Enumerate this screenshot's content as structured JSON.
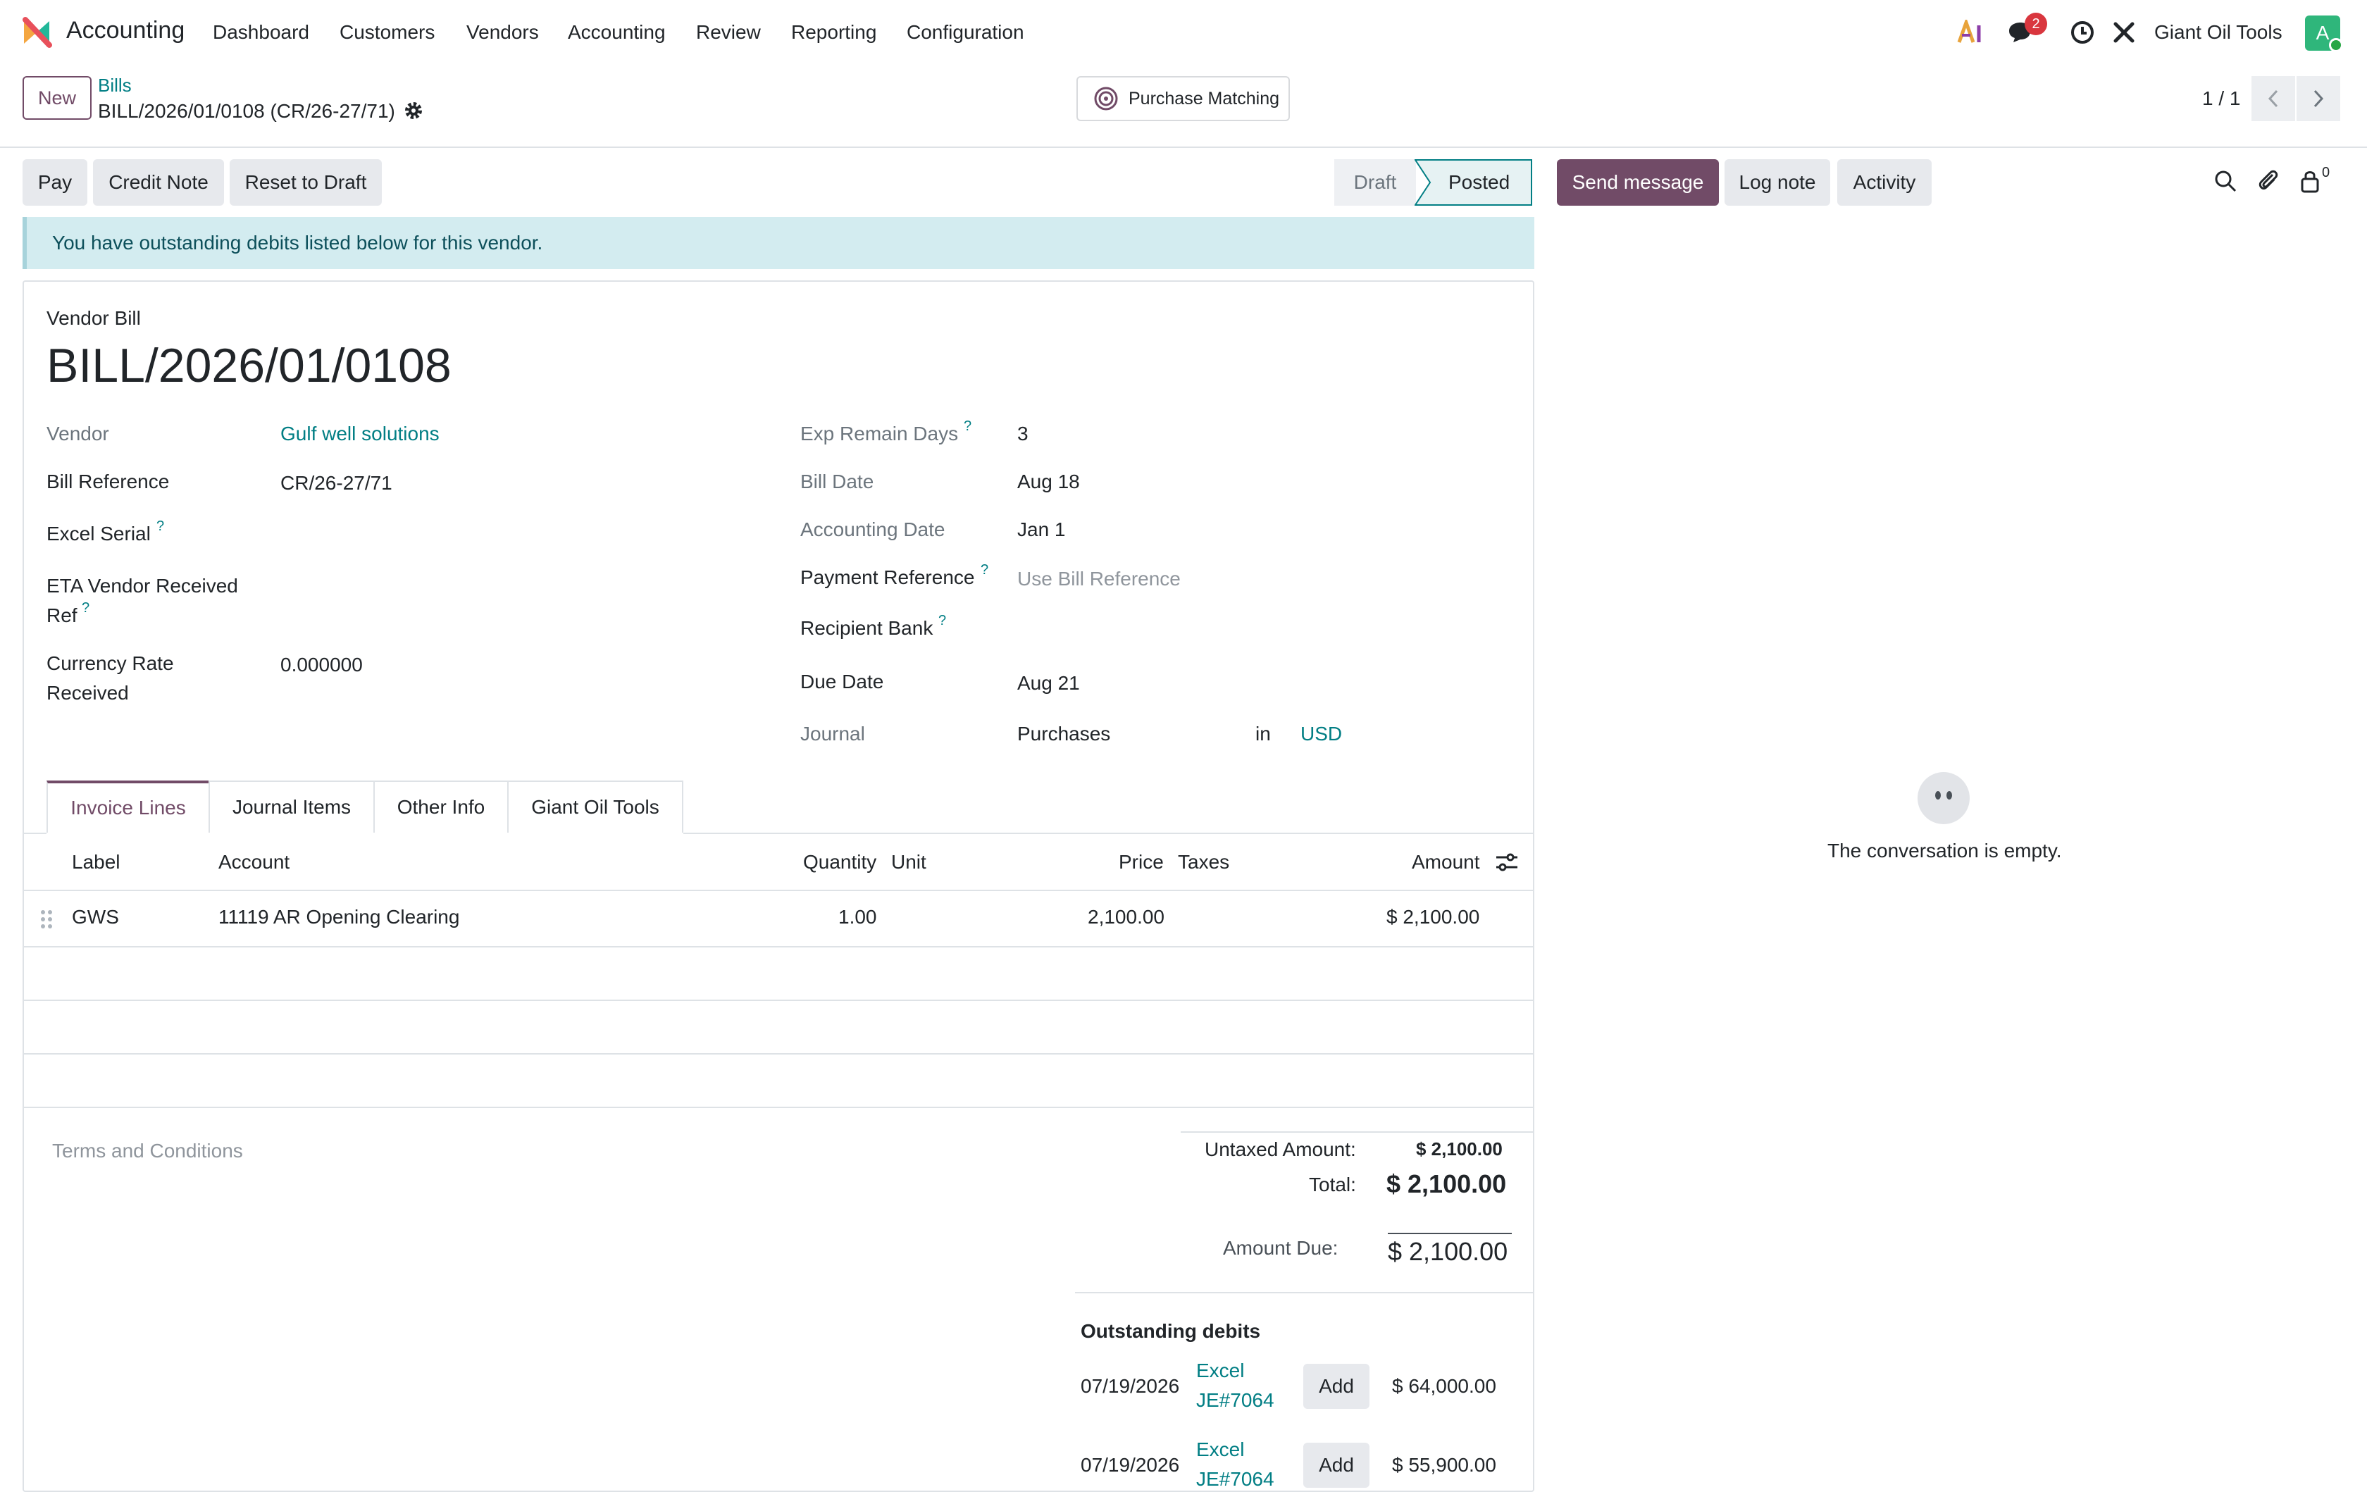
{
  "nav": {
    "app_name": "Accounting",
    "menu": [
      "Dashboard",
      "Customers",
      "Vendors",
      "Accounting",
      "Review",
      "Reporting",
      "Configuration"
    ],
    "messages_count": "2",
    "company": "Giant Oil Tools",
    "avatar_letter": "A"
  },
  "control": {
    "new_label": "New",
    "breadcrumb_parent": "Bills",
    "breadcrumb_current": "BILL/2026/01/0108 (CR/26-27/71)",
    "purchase_matching": "Purchase Matching",
    "pager": "1 / 1"
  },
  "actions": {
    "pay": "Pay",
    "credit_note": "Credit Note",
    "reset_to_draft": "Reset to Draft",
    "status_draft": "Draft",
    "status_posted": "Posted",
    "send_message": "Send message",
    "log_note": "Log note",
    "activity": "Activity",
    "followers_count": "0"
  },
  "alert": "You have outstanding debits listed below for this vendor.",
  "form": {
    "doc_type": "Vendor Bill",
    "name": "BILL/2026/01/0108",
    "vendor_label": "Vendor",
    "vendor_value": "Gulf well solutions",
    "bill_ref_label": "Bill Reference",
    "bill_ref_value": "CR/26-27/71",
    "excel_serial_label": "Excel Serial",
    "eta_label_1": "ETA Vendor Received",
    "eta_label_2": "Ref",
    "currency_rate_label_1": "Currency Rate",
    "currency_rate_label_2": "Received",
    "currency_rate_value": "0.000000",
    "exp_remain_label": "Exp Remain Days",
    "exp_remain_value": "3",
    "bill_date_label": "Bill Date",
    "bill_date_value": "Aug 18",
    "accounting_date_label": "Accounting Date",
    "accounting_date_value": "Jan 1",
    "payment_ref_label": "Payment Reference",
    "payment_ref_placeholder": "Use Bill Reference",
    "recipient_bank_label": "Recipient Bank",
    "due_date_label": "Due Date",
    "due_date_value": "Aug 21",
    "journal_label": "Journal",
    "journal_value": "Purchases",
    "journal_in": "in",
    "journal_currency": "USD",
    "help_mark": "?"
  },
  "tabs": [
    "Invoice Lines",
    "Journal Items",
    "Other Info",
    "Giant Oil Tools"
  ],
  "lines": {
    "headers": {
      "label": "Label",
      "account": "Account",
      "quantity": "Quantity",
      "unit": "Unit",
      "price": "Price",
      "taxes": "Taxes",
      "amount": "Amount"
    },
    "rows": [
      {
        "label": "GWS",
        "account": "11119 AR Opening Clearing",
        "quantity": "1.00",
        "unit": "",
        "price": "2,100.00",
        "taxes": "",
        "amount": "$ 2,100.00"
      }
    ]
  },
  "totals": {
    "terms_placeholder": "Terms and Conditions",
    "untaxed_label": "Untaxed Amount:",
    "untaxed_value": "$ 2,100.00",
    "total_label": "Total:",
    "total_value": "$ 2,100.00",
    "amount_due_label": "Amount Due:",
    "amount_due_value": "$ 2,100.00"
  },
  "outstanding": {
    "title": "Outstanding debits",
    "add_label": "Add",
    "items": [
      {
        "date": "07/19/2026",
        "ref_1": "Excel",
        "ref_2": "JE#7064",
        "amount": "$ 64,000.00"
      },
      {
        "date": "07/19/2026",
        "ref_1": "Excel",
        "ref_2": "JE#7064",
        "amount": "$ 55,900.00"
      }
    ]
  },
  "chatter": {
    "empty_text": "The conversation is empty."
  }
}
